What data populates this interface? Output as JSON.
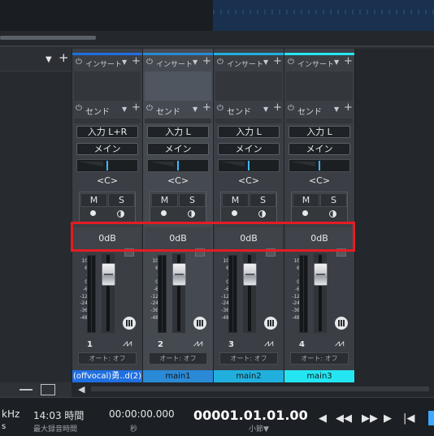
{
  "colors": {
    "ch1": "#1f6fe0",
    "ch2": "#2a8ad6",
    "ch3": "#21b0de",
    "ch4": "#24e6f2",
    "highlight": "#e41c24"
  },
  "channels": [
    {
      "insert": "インサート",
      "send": "センド",
      "input": "入力 L+R",
      "output": "メイン",
      "pan": "<C>",
      "mute": "M",
      "solo": "S",
      "volume": "0dB",
      "number": "1",
      "auto": "オート: オフ",
      "name": "(offvocal)勇..d(2)",
      "selected": false
    },
    {
      "insert": "インサート",
      "send": "センド",
      "input": "入力 L",
      "output": "メイン",
      "pan": "<C>",
      "mute": "M",
      "solo": "S",
      "volume": "0dB",
      "number": "2",
      "auto": "オート: オフ",
      "name": "main1",
      "selected": true
    },
    {
      "insert": "インサート",
      "send": "センド",
      "input": "入力 L",
      "output": "メイン",
      "pan": "<C>",
      "mute": "M",
      "solo": "S",
      "volume": "0dB",
      "number": "3",
      "auto": "オート: オフ",
      "name": "main2",
      "selected": false
    },
    {
      "insert": "インサート",
      "send": "センド",
      "input": "入力 L",
      "output": "メイン",
      "pan": "<C>",
      "mute": "M",
      "solo": "S",
      "volume": "0dB",
      "number": "4",
      "auto": "オート: オフ",
      "name": "main3",
      "selected": false
    }
  ],
  "meter_scale": [
    "10",
    "6",
    "-",
    "0",
    "-6",
    "-12",
    "-24",
    "-36",
    "-48"
  ],
  "transport": {
    "rate_fragment": "kHz",
    "rate_sub_fragment": "s",
    "record_time": "14:03 時間",
    "record_time_label": "最大録音時間",
    "seconds": "00:00:00.000",
    "seconds_label": "秒",
    "bars": "00001.01.01.00",
    "bars_label": "小節"
  },
  "icons": {
    "power": "power-icon",
    "dropdown": "chevron-down-icon",
    "plus": "plus-icon"
  }
}
